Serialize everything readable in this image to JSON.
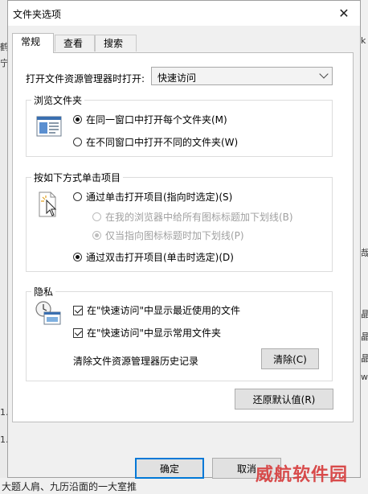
{
  "window": {
    "title": "文件夹选项"
  },
  "tabs": [
    {
      "label": "常规",
      "active": true
    },
    {
      "label": "查看",
      "active": false
    },
    {
      "label": "搜索",
      "active": false
    }
  ],
  "open_in": {
    "label": "打开文件资源管理器时打开:",
    "selected": "快速访问"
  },
  "browse_group": {
    "title": "浏览文件夹",
    "options": [
      {
        "label": "在同一窗口中打开每个文件夹(M)",
        "checked": true
      },
      {
        "label": "在不同窗口中打开不同的文件夹(W)",
        "checked": false
      }
    ]
  },
  "click_group": {
    "title": "按如下方式单击项目",
    "single_click": {
      "label": "通过单击打开项目(指向时选定)(S)",
      "checked": false
    },
    "underline_all": {
      "label": "在我的浏览器中给所有图标标题加下划线(B)",
      "checked": false,
      "disabled": true
    },
    "underline_point": {
      "label": "仅当指向图标标题时加下划线(P)",
      "checked": true,
      "disabled": true
    },
    "double_click": {
      "label": "通过双击打开项目(单击时选定)(D)",
      "checked": true
    }
  },
  "privacy_group": {
    "title": "隐私",
    "recent_files": {
      "label": "在\"快速访问\"中显示最近使用的文件",
      "checked": true
    },
    "frequent_folders": {
      "label": "在\"快速访问\"中显示常用文件夹",
      "checked": true
    },
    "clear_label": "清除文件资源管理器历史记录",
    "clear_button": "清除(C)"
  },
  "restore_button": "还原默认值(R)",
  "footer": {
    "ok": "确定",
    "cancel": "取消"
  },
  "watermark": "威航软件园",
  "background": {
    "left_fragments": [
      "鹤",
      "宁",
      "1.",
      "1."
    ],
    "right_fragments": [
      "k",
      "哉",
      "晶",
      "晶",
      "晶",
      "w"
    ],
    "bottom_text": "大题人肩、九历沿面的一大室推"
  }
}
